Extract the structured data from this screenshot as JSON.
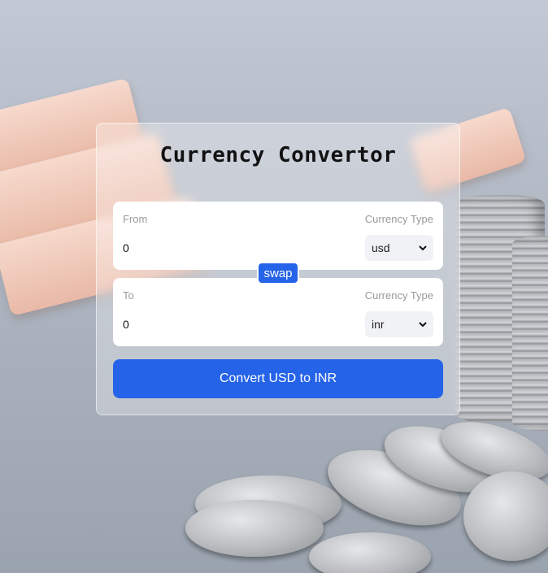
{
  "app": {
    "title": "Currency Convertor"
  },
  "from_box": {
    "label": "From",
    "currency_type_label": "Currency Type",
    "amount_value": "0",
    "currency_selected": "usd"
  },
  "swap": {
    "label": "swap"
  },
  "to_box": {
    "label": "To",
    "currency_type_label": "Currency Type",
    "amount_value": "0",
    "currency_selected": "inr"
  },
  "convert": {
    "label": "Convert USD to INR"
  },
  "colors": {
    "accent": "#2563e8"
  },
  "icons": {
    "select_arrow": "chevron-down-icon"
  }
}
